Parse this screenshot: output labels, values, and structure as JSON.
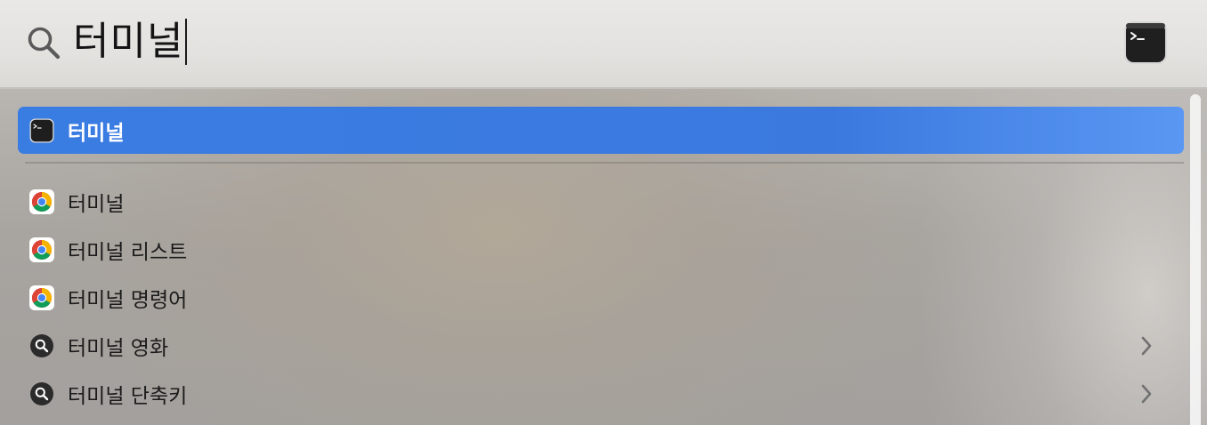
{
  "search": {
    "query": "터미널",
    "icon": "search-icon",
    "preview_icon": "terminal-app-icon"
  },
  "top_hit": {
    "label": "터미널",
    "icon": "terminal-app-icon",
    "selected": true
  },
  "results": [
    {
      "label": "터미널",
      "icon": "chrome-icon",
      "has_chevron": false
    },
    {
      "label": "터미널 리스트",
      "icon": "chrome-icon",
      "has_chevron": false
    },
    {
      "label": "터미널 명령어",
      "icon": "chrome-icon",
      "has_chevron": false
    },
    {
      "label": "터미널 영화",
      "icon": "search-suggestion-icon",
      "has_chevron": true
    },
    {
      "label": "터미널 단축키",
      "icon": "search-suggestion-icon",
      "has_chevron": true
    }
  ],
  "colors": {
    "selection": "#3a7de2",
    "text": "#1b1b1b",
    "selected_text": "#ffffff"
  }
}
